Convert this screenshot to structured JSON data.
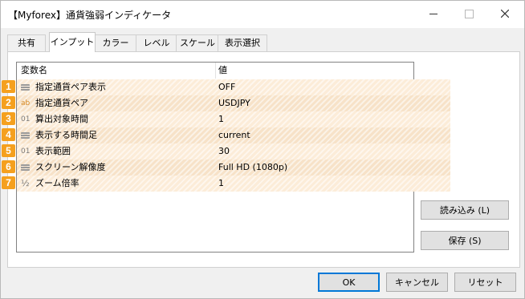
{
  "window": {
    "title": "【Myforex】通貨強弱インディケータ"
  },
  "tabs": [
    {
      "label": "共有",
      "active": false
    },
    {
      "label": "インプット",
      "active": true
    },
    {
      "label": "カラー",
      "active": false
    },
    {
      "label": "レベル",
      "active": false
    },
    {
      "label": "スケール",
      "active": false
    },
    {
      "label": "表示選択",
      "active": false
    }
  ],
  "table": {
    "headers": {
      "name": "変数名",
      "value": "値"
    },
    "rows": [
      {
        "badge": "1",
        "icon": "enum-list-icon",
        "name": "指定通貨ペア表示",
        "value": "OFF"
      },
      {
        "badge": "2",
        "icon": "string-ab-icon",
        "glyph": "ab",
        "name": "指定通貨ペア",
        "value": "USDJPY"
      },
      {
        "badge": "3",
        "icon": "integer-01-icon",
        "glyph": "01",
        "name": "算出対象時間",
        "value": "1"
      },
      {
        "badge": "4",
        "icon": "enum-list-icon",
        "name": "表示する時間足",
        "value": "current"
      },
      {
        "badge": "5",
        "icon": "integer-01-icon",
        "glyph": "01",
        "name": "表示範囲",
        "value": "30"
      },
      {
        "badge": "6",
        "icon": "enum-list-icon",
        "name": "スクリーン解像度",
        "value": "Full HD (1080p)"
      },
      {
        "badge": "7",
        "icon": "double-half-icon",
        "glyph": "½",
        "name": "ズーム倍率",
        "value": "1"
      }
    ]
  },
  "side_buttons": {
    "load": "読み込み (L)",
    "save": "保存 (S)"
  },
  "footer_buttons": {
    "ok": "OK",
    "cancel": "キャンセル",
    "reset": "リセット"
  },
  "colors": {
    "badge": "#f5a01e",
    "row_highlight": "#fcecd8",
    "ok_border": "#0078d7"
  }
}
